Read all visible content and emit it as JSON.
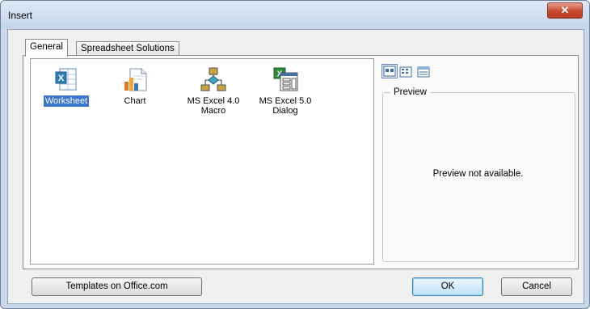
{
  "dialog": {
    "title": "Insert",
    "close_glyph": "✕"
  },
  "tabs": [
    {
      "label": "General",
      "selected": true
    },
    {
      "label": "Spreadsheet Solutions",
      "selected": false
    }
  ],
  "items": [
    {
      "label": "Worksheet",
      "icon": "worksheet-icon",
      "selected": true
    },
    {
      "label": "Chart",
      "icon": "chart-icon",
      "selected": false
    },
    {
      "label_line1": "MS Excel 4.0",
      "label_line2": "Macro",
      "icon": "macro-icon",
      "selected": false
    },
    {
      "label_line1": "MS Excel 5.0",
      "label_line2": "Dialog",
      "icon": "dialog-sheet-icon",
      "selected": false
    }
  ],
  "view_buttons": [
    {
      "name": "large-icons-view",
      "active": true
    },
    {
      "name": "list-view",
      "active": false
    },
    {
      "name": "details-view",
      "active": false
    }
  ],
  "preview": {
    "legend": "Preview",
    "message": "Preview not available."
  },
  "buttons": {
    "templates": "Templates on Office.com",
    "ok": "OK",
    "cancel": "Cancel"
  },
  "colors": {
    "selection": "#3b75c9",
    "titlebar": "#c4d5ea",
    "close_button": "#c9482f",
    "default_button_border": "#3c7fb1"
  }
}
